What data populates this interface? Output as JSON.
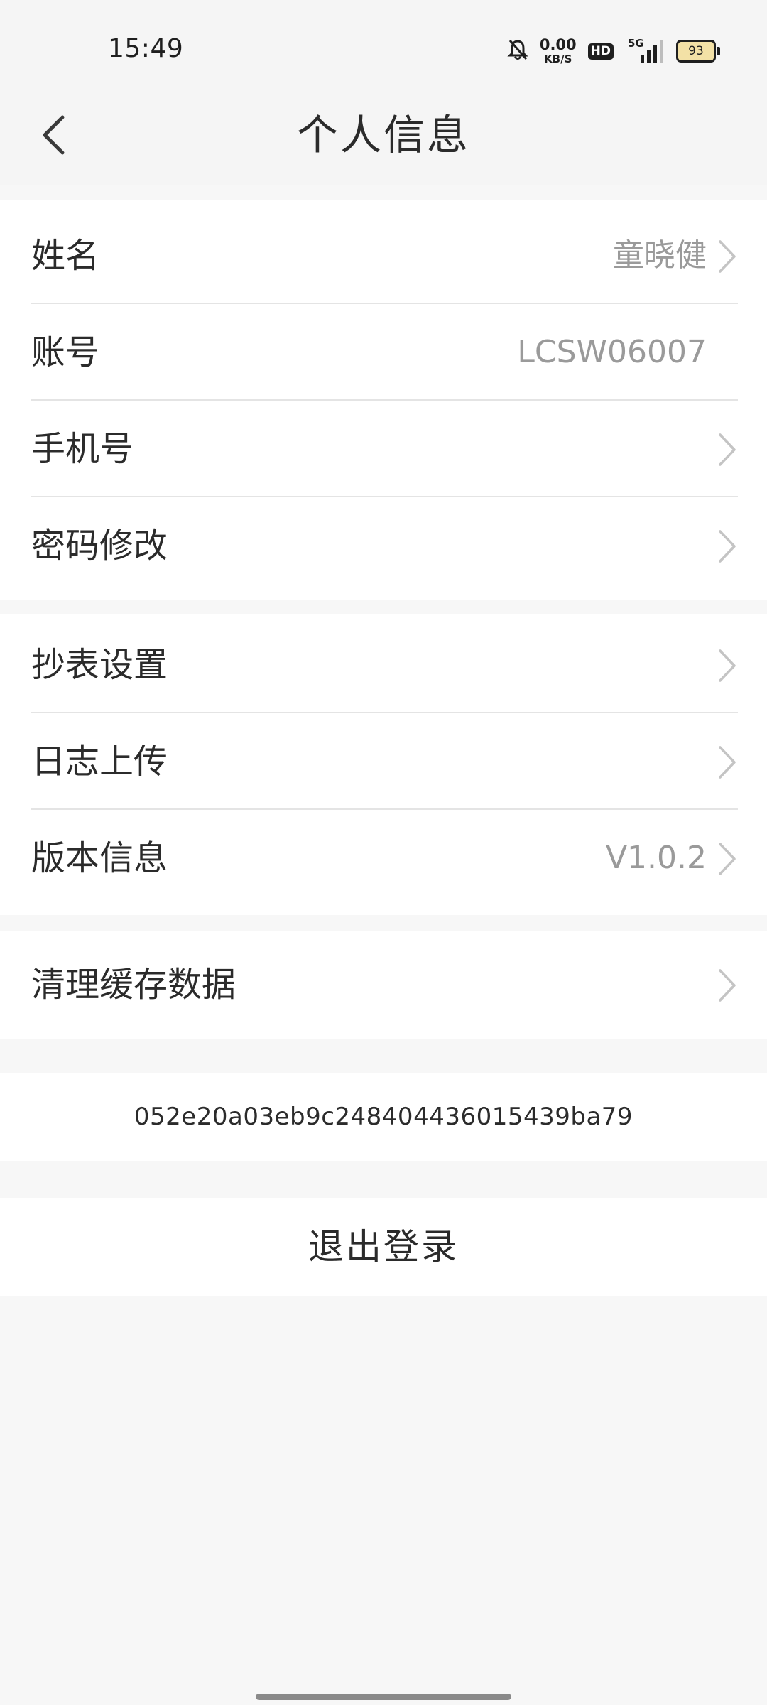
{
  "status_bar": {
    "time": "15:49",
    "net_speed_value": "0.00",
    "net_speed_unit": "KB/S",
    "hd_label": "HD",
    "signal_label": "5G",
    "battery_level": "93"
  },
  "header": {
    "title": "个人信息"
  },
  "group1": [
    {
      "label": "姓名",
      "value": "童晓健"
    },
    {
      "label": "账号",
      "value": "LCSW06007"
    },
    {
      "label": "手机号",
      "value": ""
    },
    {
      "label": "密码修改",
      "value": ""
    }
  ],
  "group2": [
    {
      "label": "抄表设置",
      "value": ""
    },
    {
      "label": "日志上传",
      "value": ""
    },
    {
      "label": "版本信息",
      "value": "V1.0.2"
    }
  ],
  "group3": [
    {
      "label": "清理缓存数据",
      "value": ""
    }
  ],
  "device_id": "052e20a03eb9c248404436015439ba79",
  "logout_label": "退出登录",
  "colors": {
    "background": "#f7f7f7",
    "card": "#ffffff",
    "text": "#2b2b2b",
    "secondary_text": "#9a9a9a",
    "divider": "#e4e4e4",
    "battery_fill": "#f3e1a6"
  }
}
